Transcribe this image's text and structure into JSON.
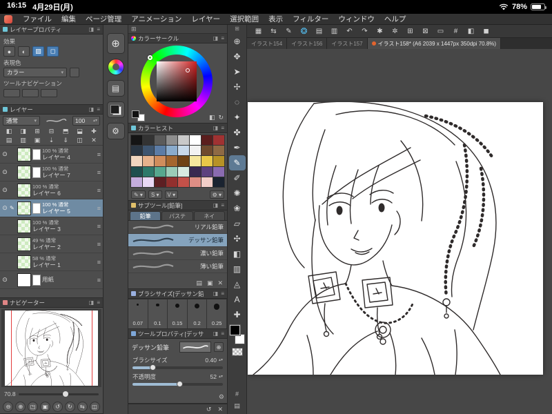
{
  "statusbar": {
    "time": "16:15",
    "date": "4月29日(月)",
    "battery_percent": "78%"
  },
  "menubar": {
    "items": [
      "ファイル",
      "編集",
      "ページ管理",
      "アニメーション",
      "レイヤー",
      "選択範囲",
      "表示",
      "フィルター",
      "ウィンドウ",
      "ヘルプ"
    ]
  },
  "ui": {
    "dropdown_arrow": "▾",
    "stepper_arrows": "▴▾",
    "hamburger": "≡",
    "collapse": "◨"
  },
  "command_bar": {
    "icons": [
      {
        "name": "workspace-grid-icon",
        "glyph": "▦"
      },
      {
        "name": "switch-view-icon",
        "glyph": "⇆"
      },
      {
        "name": "pen-settings-icon",
        "glyph": "✎"
      },
      {
        "name": "clip-studio-logo-icon",
        "glyph": "❂"
      },
      {
        "name": "new-canvas-icon",
        "glyph": "▤"
      },
      {
        "name": "import-icon",
        "glyph": "▥"
      },
      {
        "name": "undo-icon",
        "glyph": "↶"
      },
      {
        "name": "redo-icon",
        "glyph": "↷"
      },
      {
        "name": "clear-icon",
        "glyph": "✱"
      },
      {
        "name": "fill-command-icon",
        "glyph": "✲"
      },
      {
        "name": "scale-rotate-icon",
        "glyph": "⊞"
      },
      {
        "name": "free-transform-icon",
        "glyph": "⊠"
      },
      {
        "name": "selection-launcher-icon",
        "glyph": "▭"
      },
      {
        "name": "grid-toggle-icon",
        "glyph": "#"
      },
      {
        "name": "snap-to-ruler-icon",
        "glyph": "◧"
      },
      {
        "name": "special-ruler-icon",
        "glyph": "◼"
      }
    ]
  },
  "tabs": [
    {
      "label": "イラスト154",
      "active": false
    },
    {
      "label": "イラスト156",
      "active": false
    },
    {
      "label": "イラスト157",
      "active": false
    },
    {
      "label": "イラスト158* (A6 2039 x 1447px 350dpi 70.8%)",
      "active": true
    }
  ],
  "layer_property": {
    "title": "レイヤープロパティ",
    "effect_label": "効果",
    "effect_icons": [
      {
        "name": "border-effect-icon",
        "glyph": "●",
        "active": false
      },
      {
        "name": "tone-effect-icon",
        "glyph": "◐",
        "active": false
      },
      {
        "name": "layer-color-icon",
        "glyph": "▨",
        "active": true
      },
      {
        "name": "expression-color-icon",
        "glyph": "◻",
        "active": true
      }
    ],
    "expression_label": "表現色",
    "expression_value": "カラー"
  },
  "tool_navigation": {
    "label": "ツールナビゲーション",
    "buttons": [
      {
        "name": "tool-nav-slot-1"
      },
      {
        "name": "tool-nav-slot-2"
      },
      {
        "name": "tool-nav-slot-3"
      }
    ]
  },
  "layers_panel": {
    "title": "レイヤー",
    "blend_mode": "通常",
    "opacity_value": "100",
    "command_icons_row1": [
      {
        "name": "clip-at-layer-below-icon",
        "glyph": "◧"
      },
      {
        "name": "lock-layer-icon",
        "glyph": "◨"
      },
      {
        "name": "lock-transparent-pixels-icon",
        "glyph": "⊞"
      },
      {
        "name": "enable-mask-icon",
        "glyph": "⊟"
      },
      {
        "name": "set-as-ruler-icon",
        "glyph": "⬒"
      },
      {
        "name": "layer-color-toggle-icon",
        "glyph": "⬓"
      },
      {
        "name": "add-effect-icon",
        "glyph": "✚"
      }
    ],
    "command_icons_row2": [
      {
        "name": "new-raster-layer-icon",
        "glyph": "▤"
      },
      {
        "name": "new-vector-layer-icon",
        "glyph": "▥"
      },
      {
        "name": "new-layer-folder-icon",
        "glyph": "▣"
      },
      {
        "name": "transfer-to-layer-below-icon",
        "glyph": "⇣"
      },
      {
        "name": "merge-with-layer-below-icon",
        "glyph": "⇓"
      },
      {
        "name": "create-layer-mask-icon",
        "glyph": "◫"
      },
      {
        "name": "delete-layer-icon",
        "glyph": "✕"
      }
    ],
    "rows": [
      {
        "visible": true,
        "editing": false,
        "opacity": "100 %",
        "mode": "通常",
        "name": "レイヤー 4",
        "selected": false,
        "thumb": "green",
        "page": true
      },
      {
        "visible": true,
        "editing": false,
        "opacity": "100 %",
        "mode": "通常",
        "name": "レイヤー 7",
        "selected": false,
        "thumb": "green",
        "page": true
      },
      {
        "visible": true,
        "editing": false,
        "opacity": "100 %",
        "mode": "通常",
        "name": "レイヤー 6",
        "selected": false,
        "thumb": "green",
        "page": false
      },
      {
        "visible": true,
        "editing": true,
        "opacity": "100 %",
        "mode": "通常",
        "name": "レイヤー 5",
        "selected": true,
        "thumb": "green",
        "page": true
      },
      {
        "visible": false,
        "editing": false,
        "opacity": "100 %",
        "mode": "通常",
        "name": "レイヤー 3",
        "selected": false,
        "thumb": "green",
        "page": false
      },
      {
        "visible": false,
        "editing": false,
        "opacity": "49 %",
        "mode": "通常",
        "name": "レイヤー 2",
        "selected": false,
        "thumb": "green",
        "page": false
      },
      {
        "visible": false,
        "editing": false,
        "opacity": "58 %",
        "mode": "通常",
        "name": "レイヤー 1",
        "selected": false,
        "thumb": "green",
        "page": false
      },
      {
        "visible": true,
        "editing": false,
        "opacity": "",
        "mode": "",
        "name": "用紙",
        "selected": false,
        "thumb": "paper",
        "page": true
      }
    ]
  },
  "navigator": {
    "title": "ナビゲーター",
    "zoom_value": "70.8",
    "buttons": [
      {
        "name": "zoom-out-icon",
        "glyph": "⊖"
      },
      {
        "name": "zoom-in-icon",
        "glyph": "⊕"
      },
      {
        "name": "fit-to-screen-icon",
        "glyph": "◳"
      },
      {
        "name": "actual-size-icon",
        "glyph": "▣"
      },
      {
        "name": "rotate-left-icon",
        "glyph": "↺"
      },
      {
        "name": "rotate-right-icon",
        "glyph": "↻"
      },
      {
        "name": "flip-horizontal-icon",
        "glyph": "⇆"
      },
      {
        "name": "reset-view-icon",
        "glyph": "◫"
      }
    ]
  },
  "palette_dock": {
    "buttons": [
      {
        "name": "tool-navigation-button",
        "type": "magnifier",
        "glyph": "⊕"
      },
      {
        "name": "color-wheel-palette-button",
        "type": "wheel",
        "glyph": ""
      },
      {
        "name": "color-slider-palette-button",
        "type": "slider",
        "glyph": "▤"
      },
      {
        "name": "color-set-palette-button",
        "type": "chips",
        "glyph": ""
      },
      {
        "name": "palette-settings-button",
        "type": "gear",
        "glyph": "⚙"
      }
    ]
  },
  "color_wheel": {
    "title": "カラーサークル",
    "footer_icons": [
      {
        "name": "square-circle-toggle-icon",
        "glyph": "◧"
      },
      {
        "name": "hsv-toggle-icon",
        "glyph": "↻"
      }
    ]
  },
  "color_set": {
    "title": "カラーヒスト",
    "swatches": [
      "#151515",
      "#333333",
      "#5b5b5b",
      "#8e8e8e",
      "#c9c9c9",
      "#ffffff",
      "#5a1d1d",
      "#a03232",
      "#2a3642",
      "#3e5570",
      "#5c7ca6",
      "#8aabcc",
      "#c8d9ea",
      "#f2f2f2",
      "#6e4a2e",
      "#8f6a44",
      "#f0d6bf",
      "#e6b28c",
      "#d08d5c",
      "#a5662e",
      "#6f4316",
      "#f6e79e",
      "#e7c748",
      "#b79226",
      "#1f4f4e",
      "#2e796a",
      "#57a78e",
      "#9bccb8",
      "#d8ece2",
      "#3a2951",
      "#5d427f",
      "#8a6bb0",
      "#c5addd",
      "#e9d8f4",
      "#5d1f23",
      "#92302e",
      "#c35149",
      "#df8e85",
      "#f2cec8",
      "#1a2330"
    ],
    "footer_icons": [
      {
        "name": "edit-color-icon",
        "glyph": "✎"
      },
      {
        "name": "saturation-button",
        "glyph": "S"
      },
      {
        "name": "value-button",
        "glyph": "V"
      },
      {
        "name": "color-set-settings-icon",
        "glyph": "⚙"
      }
    ]
  },
  "subtool": {
    "title": "サブツール[鉛筆]",
    "tabs": [
      {
        "label": "鉛筆",
        "active": true
      },
      {
        "label": "パステ",
        "active": false
      },
      {
        "label": "ネイ",
        "active": false
      }
    ],
    "items": [
      {
        "name": "リアル鉛筆",
        "selected": false
      },
      {
        "name": "デッサン鉛筆",
        "selected": true
      },
      {
        "name": "濃い鉛筆",
        "selected": false
      },
      {
        "name": "薄い鉛筆",
        "selected": false
      }
    ],
    "footer_icons": [
      {
        "name": "new-subtool-icon",
        "glyph": "▤"
      },
      {
        "name": "duplicate-subtool-icon",
        "glyph": "▣"
      },
      {
        "name": "delete-subtool-icon",
        "glyph": "✕"
      }
    ]
  },
  "brush_size": {
    "title": "ブラシサイズ[デッサン鉛",
    "presets": [
      "0.07",
      "0.1",
      "0.15",
      "0.2",
      "0.25"
    ]
  },
  "tool_property": {
    "title": "ツールプロパティ[デッサ",
    "tool_name": "デッサン鉛筆",
    "wrench_glyph": "⚙",
    "sliders": [
      {
        "label": "ブラシサイズ",
        "value": "0.40",
        "percent": 22
      },
      {
        "label": "不透明度",
        "value": "52",
        "percent": 52
      }
    ]
  },
  "mid_footer_icons": [
    {
      "name": "reset-settings-icon",
      "glyph": "↺"
    },
    {
      "name": "delete-settings-icon",
      "glyph": "✕"
    }
  ],
  "toolbox": {
    "tools": [
      {
        "name": "zoom-tool",
        "glyph": "⊕",
        "selected": false
      },
      {
        "name": "move-tool",
        "glyph": "✥",
        "selected": false
      },
      {
        "name": "operation-tool",
        "glyph": "➤",
        "selected": false
      },
      {
        "name": "layer-move-tool",
        "glyph": "✢",
        "selected": false
      },
      {
        "name": "selection-tool",
        "glyph": "◌",
        "selected": false
      },
      {
        "name": "auto-select-tool",
        "glyph": "✦",
        "selected": false
      },
      {
        "name": "eyedropper-tool",
        "glyph": "✤",
        "selected": false
      },
      {
        "name": "pen-tool",
        "glyph": "✒",
        "selected": false
      },
      {
        "name": "pencil-tool",
        "glyph": "✎",
        "selected": true
      },
      {
        "name": "brush-tool",
        "glyph": "✐",
        "selected": false
      },
      {
        "name": "airbrush-tool",
        "glyph": "✺",
        "selected": false
      },
      {
        "name": "decoration-tool",
        "glyph": "❀",
        "selected": false
      },
      {
        "name": "eraser-tool",
        "glyph": "▱",
        "selected": false
      },
      {
        "name": "blend-tool",
        "glyph": "✣",
        "selected": false
      },
      {
        "name": "fill-tool",
        "glyph": "◧",
        "selected": false
      },
      {
        "name": "gradient-tool",
        "glyph": "▥",
        "selected": false
      },
      {
        "name": "figure-tool",
        "glyph": "◬",
        "selected": false
      },
      {
        "name": "text-tool",
        "glyph": "A",
        "selected": false
      },
      {
        "name": "correction-tool",
        "glyph": "✚",
        "selected": false
      }
    ],
    "main_color": "#000000",
    "sub_color": "#ffffff",
    "bottom_icons": [
      {
        "name": "edge-keyboard-icon",
        "glyph": "#"
      },
      {
        "name": "toolbox-menu-icon",
        "glyph": "▤"
      }
    ]
  }
}
